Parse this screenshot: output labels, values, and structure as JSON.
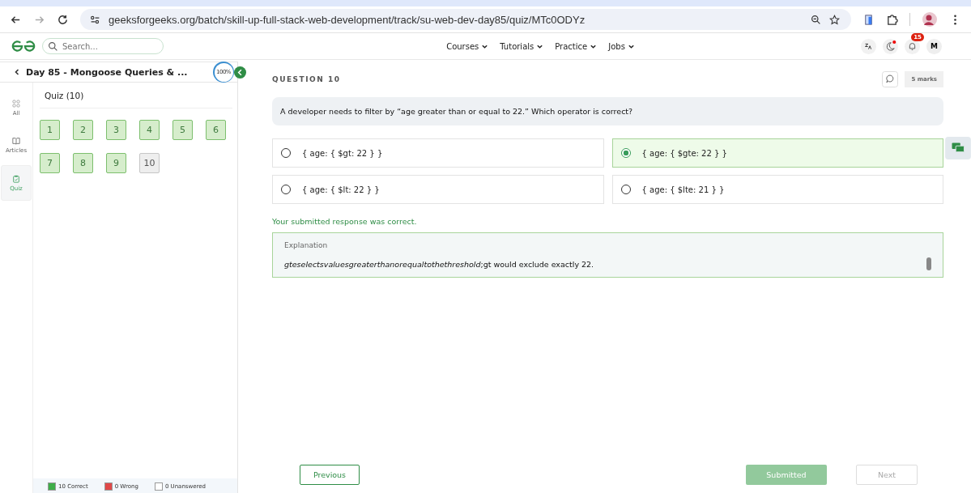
{
  "browser": {
    "url": "geeksforgeeks.org/batch/skill-up-full-stack-web-development/track/su-web-dev-day85/quiz/MTc0ODYz"
  },
  "header": {
    "search": {
      "placeholder": "Search..."
    },
    "nav": [
      "Courses",
      "Tutorials",
      "Practice",
      "Jobs"
    ],
    "notification_count": "15",
    "avatar": "M"
  },
  "sidebar": {
    "title": "Day 85 - Mongoose Queries & ...",
    "progress": {
      "label": "100%",
      "level": 1
    },
    "tabs": [
      {
        "label": "All",
        "selected": false,
        "kind": "grid"
      },
      {
        "label": "Articles",
        "selected": false,
        "kind": "book"
      },
      {
        "label": "Quiz",
        "selected": true,
        "kind": "clipboard"
      }
    ],
    "section_title": "Quiz (10)",
    "questions": [
      {
        "label": "1",
        "selected": false
      },
      {
        "label": "2",
        "selected": false
      },
      {
        "label": "3",
        "selected": false
      },
      {
        "label": "4",
        "selected": false
      },
      {
        "label": "5",
        "selected": false
      },
      {
        "label": "6",
        "selected": false
      },
      {
        "label": "7",
        "selected": false
      },
      {
        "label": "8",
        "selected": false
      },
      {
        "label": "9",
        "selected": false
      },
      {
        "label": "10",
        "selected": true
      }
    ],
    "legend": [
      {
        "label": "10 Correct",
        "color": "#3fae49"
      },
      {
        "label": "0 Wrong",
        "color": "#e04848"
      },
      {
        "label": "0 Unanswered",
        "color": "#ffffff"
      }
    ]
  },
  "question": {
    "heading": "QUESTION 10",
    "marks": "5 marks",
    "text": "A developer needs to filter by “age greater than or equal to 22.” Which operator is correct?",
    "options": [
      {
        "label": "{ age: { $gt: 22 } }",
        "selected": false
      },
      {
        "label": "{ age: { $gte: 22 } }",
        "selected": true
      },
      {
        "label": "{ age: { $lt: 22 } }",
        "selected": false
      },
      {
        "label": "{ age: { $lte: 21 } }",
        "selected": false
      }
    ],
    "result": "Your submitted response was correct.",
    "explanation": {
      "title": "Explanation",
      "text": "*gteselectsvaluesgreaterthanorequaltothethreshold*;gt would exclude exactly 22."
    }
  },
  "footer": {
    "buttons": [
      {
        "label": "Previous",
        "kind": "outline"
      },
      {
        "label": "Submitted",
        "kind": "done"
      },
      {
        "label": "Next",
        "kind": "disabled"
      }
    ]
  }
}
